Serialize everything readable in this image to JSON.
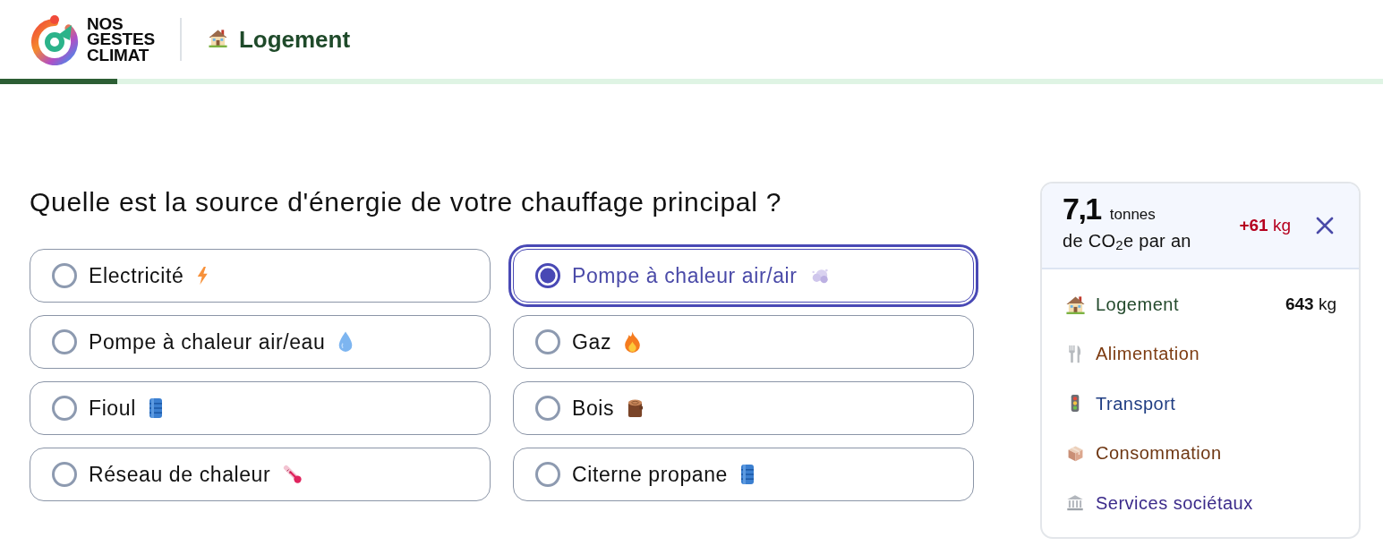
{
  "header": {
    "logo_text": "NOS GESTES CLIMAT",
    "section_title": "Logement"
  },
  "progress": {
    "level": 0.085
  },
  "question": {
    "text": "Quelle est la source d'énergie de votre chauffage principal ?",
    "options": [
      {
        "label": "Electricité",
        "selected": false
      },
      {
        "label": "Pompe à chaleur air/air",
        "selected": true
      },
      {
        "label": "Pompe à chaleur air/eau",
        "selected": false
      },
      {
        "label": "Gaz",
        "selected": false
      },
      {
        "label": "Fioul",
        "selected": false
      },
      {
        "label": "Bois",
        "selected": false
      },
      {
        "label": "Réseau de chaleur",
        "selected": false
      },
      {
        "label": "Citerne propane",
        "selected": false
      }
    ]
  },
  "summary": {
    "total": "7,1",
    "unit": "tonnes",
    "caption": "de CO$_{2}$e par an",
    "change": "**+61** kg",
    "categories": [
      {
        "label": "Logement",
        "color": "#234a2c",
        "value": "**643** kg"
      },
      {
        "label": "Alimentation",
        "color": "#7d3c12"
      },
      {
        "label": "Transport",
        "color": "#1f3d82"
      },
      {
        "label": "Consommation",
        "color": "#6e3713"
      },
      {
        "label": "Services sociétaux",
        "color": "#3b2a8a"
      }
    ]
  }
}
